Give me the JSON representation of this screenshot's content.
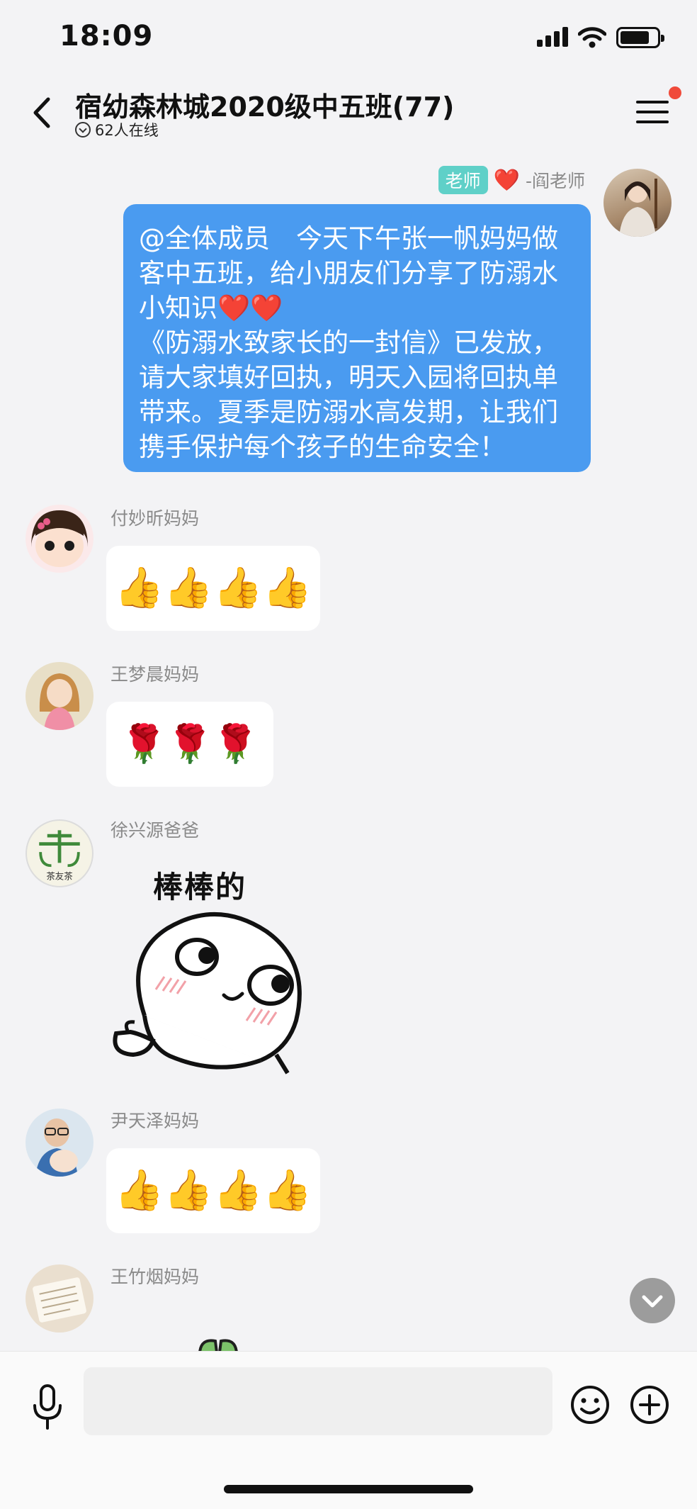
{
  "status_bar": {
    "time": "18:09"
  },
  "header": {
    "title": "宿幼森林城2020级中五班(77)",
    "online_status": "62人在线",
    "has_notification": true
  },
  "messages": [
    {
      "sender": "-阎老师",
      "role_badge": "老师",
      "heart": "❤️",
      "lines": [
        "@全体成员　今天下午张一帆妈妈做",
        "客中五班，给小朋友们分享了防溺水",
        "小知识",
        "《防溺水致家长的一封信》已发放，",
        "请大家填好回执，明天入园将回执单",
        "带来。夏季是防溺水高发期，让我们",
        "携手保护每个孩子的生命安全！"
      ],
      "hearts_inline": "❤️❤️"
    },
    {
      "sender": "付妙昕妈妈",
      "content": "👍👍👍👍"
    },
    {
      "sender": "王梦晨妈妈",
      "content": "🌹🌹🌹"
    },
    {
      "sender": "徐兴源爸爸",
      "sticker_text": "棒棒的",
      "avatar_text": "茶友茶"
    },
    {
      "sender": "尹天泽妈妈",
      "content": "👍👍👍👍"
    },
    {
      "sender": "王竹烟妈妈"
    }
  ],
  "icons": {
    "back": "chevron-left-icon",
    "menu": "hamburger-menu-icon",
    "mic": "microphone-icon",
    "emoji": "smiley-icon",
    "plus": "plus-circle-icon",
    "scroll_down": "chevron-down-icon"
  },
  "colors": {
    "bubble_blue": "#4a9bf0",
    "badge_teal": "#5fd0c8",
    "notification_red": "#f04a3a"
  }
}
